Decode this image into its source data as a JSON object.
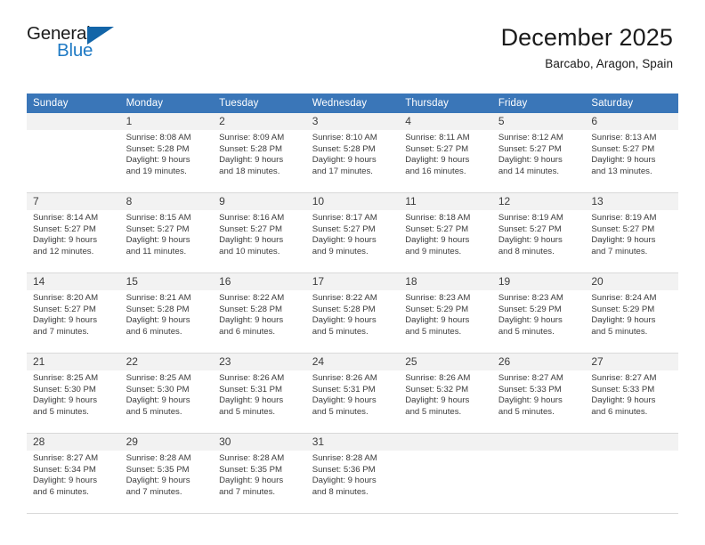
{
  "brand": {
    "name_part1": "General",
    "name_part2": "Blue",
    "triangle_color": "#1365a8",
    "blue_color": "#1f7ac4"
  },
  "header": {
    "title": "December 2025",
    "subtitle": "Barcabo, Aragon, Spain"
  },
  "theme": {
    "header_row_bg": "#3a76b8",
    "daynum_bg": "#f2f2f2",
    "cell_bg": "#ffffff",
    "text_color": "#3c3c3c",
    "border_color": "#d9d9d9"
  },
  "weekday_headers": [
    "Sunday",
    "Monday",
    "Tuesday",
    "Wednesday",
    "Thursday",
    "Friday",
    "Saturday"
  ],
  "labels": {
    "sunrise_prefix": "Sunrise:",
    "sunset_prefix": "Sunset:",
    "daylight_prefix": "Daylight:"
  },
  "weeks": [
    [
      {
        "day": ""
      },
      {
        "day": "1",
        "l1": "Sunrise: 8:08 AM",
        "l2": "Sunset: 5:28 PM",
        "l3": "Daylight: 9 hours",
        "l4": "and 19 minutes."
      },
      {
        "day": "2",
        "l1": "Sunrise: 8:09 AM",
        "l2": "Sunset: 5:28 PM",
        "l3": "Daylight: 9 hours",
        "l4": "and 18 minutes."
      },
      {
        "day": "3",
        "l1": "Sunrise: 8:10 AM",
        "l2": "Sunset: 5:28 PM",
        "l3": "Daylight: 9 hours",
        "l4": "and 17 minutes."
      },
      {
        "day": "4",
        "l1": "Sunrise: 8:11 AM",
        "l2": "Sunset: 5:27 PM",
        "l3": "Daylight: 9 hours",
        "l4": "and 16 minutes."
      },
      {
        "day": "5",
        "l1": "Sunrise: 8:12 AM",
        "l2": "Sunset: 5:27 PM",
        "l3": "Daylight: 9 hours",
        "l4": "and 14 minutes."
      },
      {
        "day": "6",
        "l1": "Sunrise: 8:13 AM",
        "l2": "Sunset: 5:27 PM",
        "l3": "Daylight: 9 hours",
        "l4": "and 13 minutes."
      }
    ],
    [
      {
        "day": "7",
        "l1": "Sunrise: 8:14 AM",
        "l2": "Sunset: 5:27 PM",
        "l3": "Daylight: 9 hours",
        "l4": "and 12 minutes."
      },
      {
        "day": "8",
        "l1": "Sunrise: 8:15 AM",
        "l2": "Sunset: 5:27 PM",
        "l3": "Daylight: 9 hours",
        "l4": "and 11 minutes."
      },
      {
        "day": "9",
        "l1": "Sunrise: 8:16 AM",
        "l2": "Sunset: 5:27 PM",
        "l3": "Daylight: 9 hours",
        "l4": "and 10 minutes."
      },
      {
        "day": "10",
        "l1": "Sunrise: 8:17 AM",
        "l2": "Sunset: 5:27 PM",
        "l3": "Daylight: 9 hours",
        "l4": "and 9 minutes."
      },
      {
        "day": "11",
        "l1": "Sunrise: 8:18 AM",
        "l2": "Sunset: 5:27 PM",
        "l3": "Daylight: 9 hours",
        "l4": "and 9 minutes."
      },
      {
        "day": "12",
        "l1": "Sunrise: 8:19 AM",
        "l2": "Sunset: 5:27 PM",
        "l3": "Daylight: 9 hours",
        "l4": "and 8 minutes."
      },
      {
        "day": "13",
        "l1": "Sunrise: 8:19 AM",
        "l2": "Sunset: 5:27 PM",
        "l3": "Daylight: 9 hours",
        "l4": "and 7 minutes."
      }
    ],
    [
      {
        "day": "14",
        "l1": "Sunrise: 8:20 AM",
        "l2": "Sunset: 5:27 PM",
        "l3": "Daylight: 9 hours",
        "l4": "and 7 minutes."
      },
      {
        "day": "15",
        "l1": "Sunrise: 8:21 AM",
        "l2": "Sunset: 5:28 PM",
        "l3": "Daylight: 9 hours",
        "l4": "and 6 minutes."
      },
      {
        "day": "16",
        "l1": "Sunrise: 8:22 AM",
        "l2": "Sunset: 5:28 PM",
        "l3": "Daylight: 9 hours",
        "l4": "and 6 minutes."
      },
      {
        "day": "17",
        "l1": "Sunrise: 8:22 AM",
        "l2": "Sunset: 5:28 PM",
        "l3": "Daylight: 9 hours",
        "l4": "and 5 minutes."
      },
      {
        "day": "18",
        "l1": "Sunrise: 8:23 AM",
        "l2": "Sunset: 5:29 PM",
        "l3": "Daylight: 9 hours",
        "l4": "and 5 minutes."
      },
      {
        "day": "19",
        "l1": "Sunrise: 8:23 AM",
        "l2": "Sunset: 5:29 PM",
        "l3": "Daylight: 9 hours",
        "l4": "and 5 minutes."
      },
      {
        "day": "20",
        "l1": "Sunrise: 8:24 AM",
        "l2": "Sunset: 5:29 PM",
        "l3": "Daylight: 9 hours",
        "l4": "and 5 minutes."
      }
    ],
    [
      {
        "day": "21",
        "l1": "Sunrise: 8:25 AM",
        "l2": "Sunset: 5:30 PM",
        "l3": "Daylight: 9 hours",
        "l4": "and 5 minutes."
      },
      {
        "day": "22",
        "l1": "Sunrise: 8:25 AM",
        "l2": "Sunset: 5:30 PM",
        "l3": "Daylight: 9 hours",
        "l4": "and 5 minutes."
      },
      {
        "day": "23",
        "l1": "Sunrise: 8:26 AM",
        "l2": "Sunset: 5:31 PM",
        "l3": "Daylight: 9 hours",
        "l4": "and 5 minutes."
      },
      {
        "day": "24",
        "l1": "Sunrise: 8:26 AM",
        "l2": "Sunset: 5:31 PM",
        "l3": "Daylight: 9 hours",
        "l4": "and 5 minutes."
      },
      {
        "day": "25",
        "l1": "Sunrise: 8:26 AM",
        "l2": "Sunset: 5:32 PM",
        "l3": "Daylight: 9 hours",
        "l4": "and 5 minutes."
      },
      {
        "day": "26",
        "l1": "Sunrise: 8:27 AM",
        "l2": "Sunset: 5:33 PM",
        "l3": "Daylight: 9 hours",
        "l4": "and 5 minutes."
      },
      {
        "day": "27",
        "l1": "Sunrise: 8:27 AM",
        "l2": "Sunset: 5:33 PM",
        "l3": "Daylight: 9 hours",
        "l4": "and 6 minutes."
      }
    ],
    [
      {
        "day": "28",
        "l1": "Sunrise: 8:27 AM",
        "l2": "Sunset: 5:34 PM",
        "l3": "Daylight: 9 hours",
        "l4": "and 6 minutes."
      },
      {
        "day": "29",
        "l1": "Sunrise: 8:28 AM",
        "l2": "Sunset: 5:35 PM",
        "l3": "Daylight: 9 hours",
        "l4": "and 7 minutes."
      },
      {
        "day": "30",
        "l1": "Sunrise: 8:28 AM",
        "l2": "Sunset: 5:35 PM",
        "l3": "Daylight: 9 hours",
        "l4": "and 7 minutes."
      },
      {
        "day": "31",
        "l1": "Sunrise: 8:28 AM",
        "l2": "Sunset: 5:36 PM",
        "l3": "Daylight: 9 hours",
        "l4": "and 8 minutes."
      },
      {
        "day": ""
      },
      {
        "day": ""
      },
      {
        "day": ""
      }
    ]
  ]
}
